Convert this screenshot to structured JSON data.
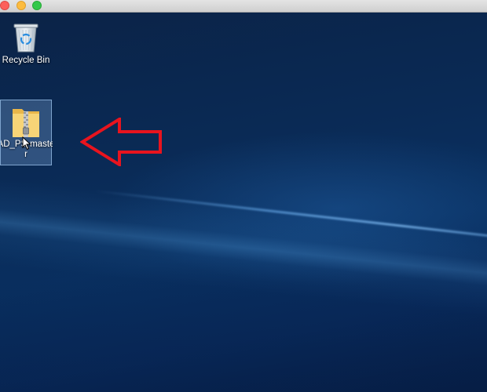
{
  "window": {
    "controls": [
      "close",
      "minimize",
      "maximize"
    ]
  },
  "desktop": {
    "icons": [
      {
        "label": "Recycle Bin",
        "icon": "recycle-bin-icon"
      },
      {
        "label_line1": "AD_PS-maste",
        "label_line2": "r",
        "icon": "zip-folder-icon",
        "selected": true
      }
    ],
    "annotation": {
      "type": "arrow",
      "direction": "left",
      "color": "#e8141e"
    }
  },
  "colors": {
    "desktop_background": "#0a2a55",
    "selection": "#78a0d2",
    "arrow": "#e8141e"
  }
}
